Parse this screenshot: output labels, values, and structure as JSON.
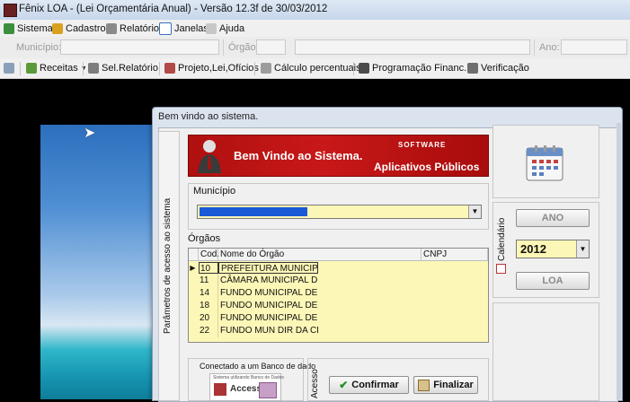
{
  "window": {
    "title": "Fênix LOA - (Lei Orçamentária Anual) - Versão 12.3f de 30/03/2012"
  },
  "menubar": {
    "items": [
      "Sistema",
      "Cadastro",
      "Relatório",
      "Janelas",
      "Ajuda"
    ]
  },
  "filterbar": {
    "municipio_label": "Município:",
    "orgao_label": "Órgão:",
    "ano_label": "Ano:"
  },
  "toolbar": {
    "items": [
      "Receitas",
      "Sel.Relatório",
      "Projeto,Lei,Ofícios",
      "Cálculo percentuais",
      "Programação Financ.",
      "Verificação"
    ]
  },
  "dialog": {
    "title": "Bem vindo ao sistema.",
    "side_label": "Parâmetros de acesso ao sistema",
    "banner": {
      "welcome": "Bem Vindo ao Sistema.",
      "apps": "Aplicativos Públicos",
      "logo": "SOFTWARE"
    },
    "municipio_group_label": "Município",
    "municipio_value": "",
    "orgaos_label": "Órgãos",
    "grid": {
      "headers": [
        "Cod.",
        "Nome do Órgão",
        "CNPJ"
      ],
      "rows": [
        {
          "cod": "10",
          "nome": "PREFEITURA MUNICIPAL DE"
        },
        {
          "cod": "11",
          "nome": "CÂMARA MUNICIPAL DE SAN"
        },
        {
          "cod": "14",
          "nome": "FUNDO MUNICIPAL DE ASSIS"
        },
        {
          "cod": "18",
          "nome": "FUNDO MUNICIPAL DE EDUC"
        },
        {
          "cod": "20",
          "nome": "FUNDO MUNICIPAL DE SAÚD"
        },
        {
          "cod": "22",
          "nome": "FUNDO MUN DIR DA CRIANÇ"
        }
      ]
    },
    "db_label": "Conectado a um Banco de dado",
    "db_logo_caption": "Sistema utilizando Banco de Dados",
    "db_logo_text": "Access",
    "acesso_label": "Acesso",
    "confirm_label": "Confirmar",
    "finalize_label": "Finalizar",
    "calendar_label": "Calendário",
    "ano_button": "ANO",
    "year_value": "2012",
    "loa_button": "LOA"
  },
  "colors": {
    "accent_red": "#c81818",
    "field_yellow": "#fdf7b7",
    "selection_blue": "#1a5ad6"
  }
}
